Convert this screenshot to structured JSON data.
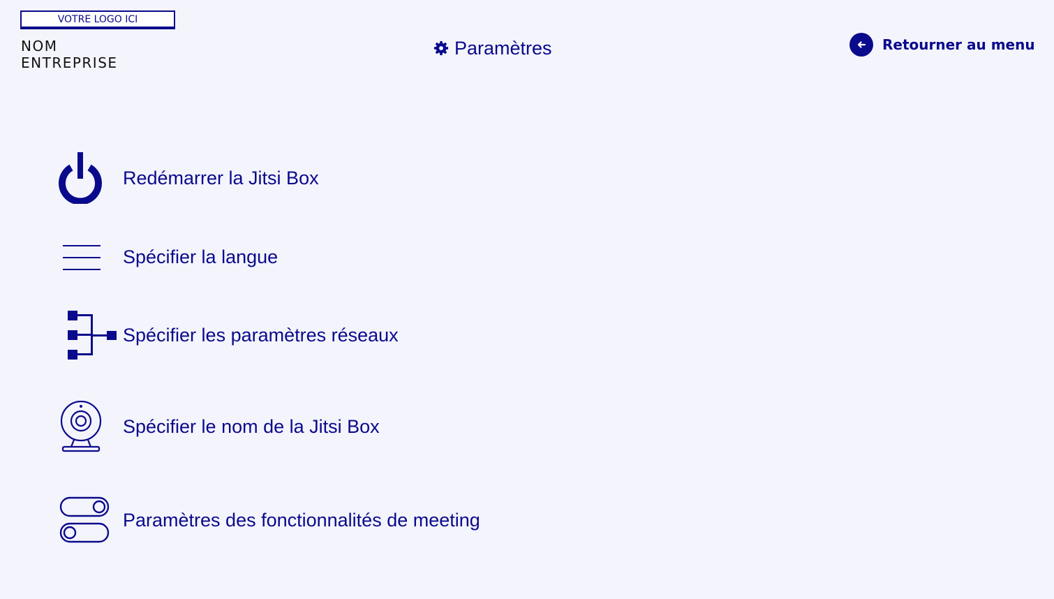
{
  "brand": {
    "logo_text": "VOTRE LOGO ICI",
    "company_line1": "NOM",
    "company_line2": "ENTREPRISE"
  },
  "header": {
    "title": "Paramètres",
    "title_icon": "gear-icon",
    "back_label": "Retourner au menu",
    "back_icon": "arrow-left-icon"
  },
  "menu": {
    "items": [
      {
        "label": "Redémarrer la Jitsi Box",
        "icon": "power-icon"
      },
      {
        "label": "Spécifier la langue",
        "icon": "lines-icon"
      },
      {
        "label": "Spécifier les paramètres réseaux",
        "icon": "network-icon"
      },
      {
        "label": "Spécifier le nom de la Jitsi Box",
        "icon": "webcam-icon"
      },
      {
        "label": "Paramètres des fonctionnalités de meeting",
        "icon": "toggles-icon"
      }
    ]
  },
  "colors": {
    "primary": "#0a0a8c",
    "background": "#f4f4fd"
  }
}
